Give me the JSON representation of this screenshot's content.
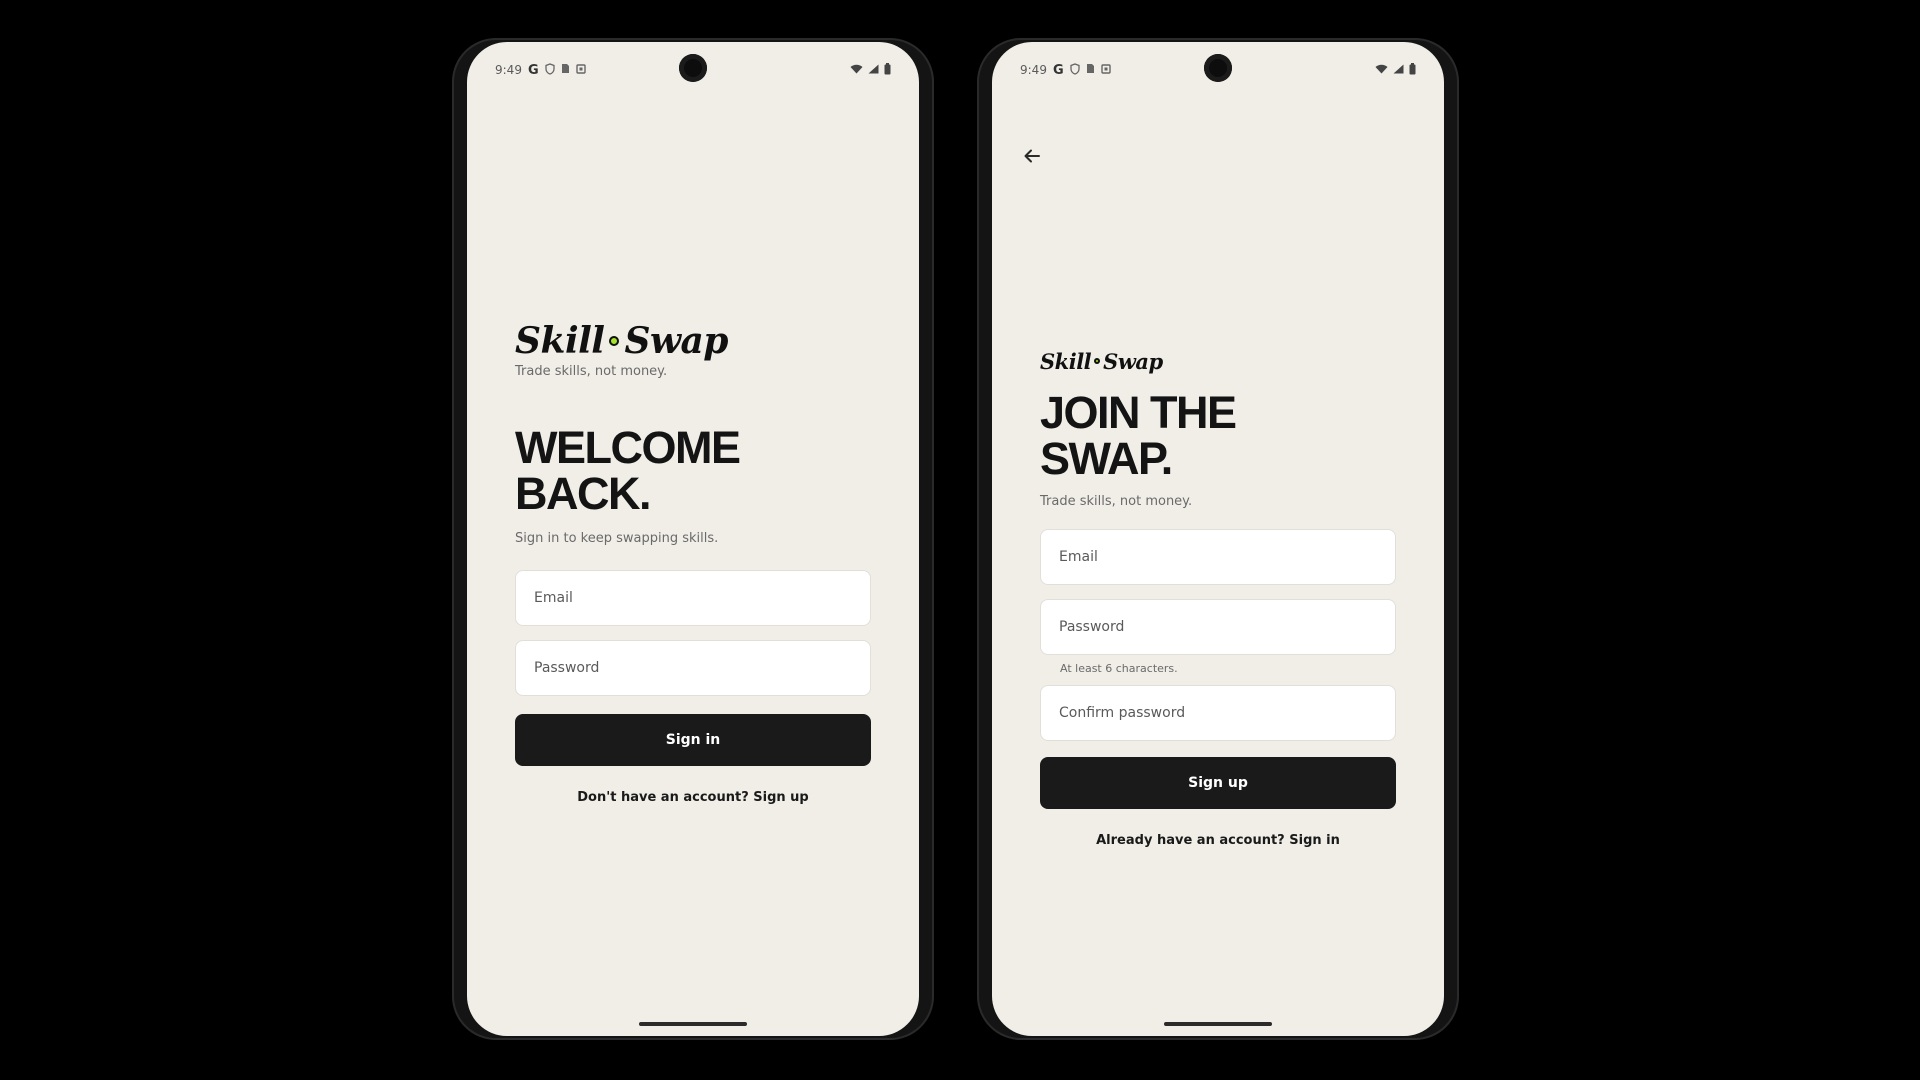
{
  "signin_screen": {
    "status": {
      "time": "9:49",
      "g": "G"
    },
    "logo": {
      "left": "Skill",
      "right": "Swap"
    },
    "tagline": "Trade skills, not money.",
    "headline_line1": "WELCOME",
    "headline_line2": "BACK.",
    "subline": "Sign in to keep swapping skills.",
    "email_placeholder": "Email",
    "password_placeholder": "Password",
    "submit_label": "Sign in",
    "switch_label": "Don't have an account? Sign up"
  },
  "signup_screen": {
    "status": {
      "time": "9:49",
      "g": "G"
    },
    "logo": {
      "left": "Skill",
      "right": "Swap"
    },
    "headline_line1": "JOIN THE",
    "headline_line2": "SWAP.",
    "tagline": "Trade skills, not money.",
    "email_placeholder": "Email",
    "password_placeholder": "Password",
    "password_helper": "At least 6 characters.",
    "confirm_placeholder": "Confirm password",
    "submit_label": "Sign up",
    "switch_label": "Already have an account? Sign in"
  },
  "theme": {
    "screen_bg": "#F1EEE8",
    "accent_dot": "#A6E22E",
    "button_bg": "#1A1A1A"
  }
}
